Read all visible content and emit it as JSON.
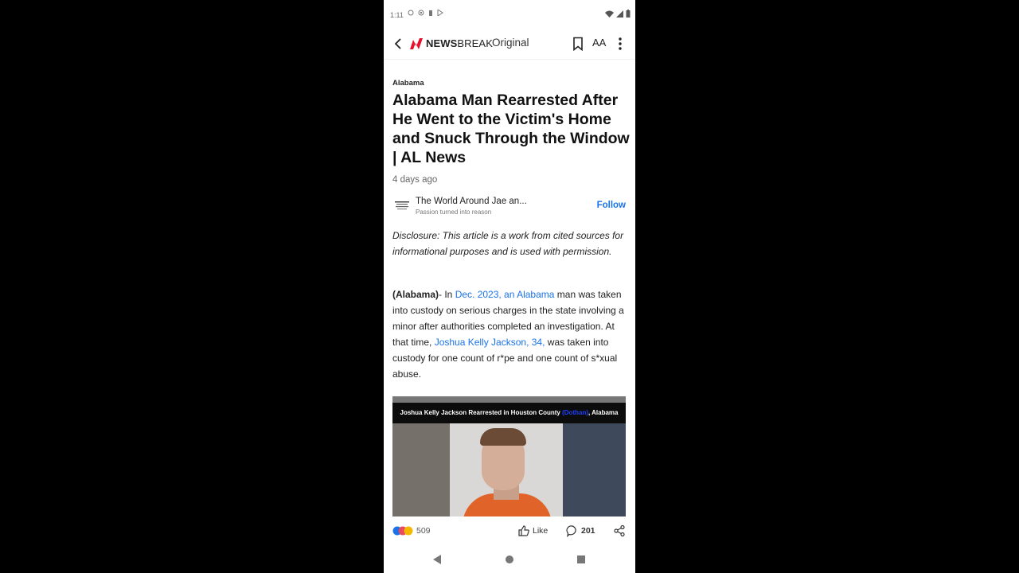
{
  "status_bar": {
    "time": "1:11"
  },
  "app_bar": {
    "brand_bold": "NEWS",
    "brand_light": "BREAK",
    "brand_suffix": "Original",
    "font_size_label": "AA"
  },
  "article": {
    "category": "Alabama",
    "headline": "Alabama Man Rearrested After He Went to the Victim's Home and Snuck Through the Window | AL News",
    "posted": "4 days ago",
    "source": {
      "name": "The World Around Jae an...",
      "tagline": "Passion turned into reason",
      "follow_label": "Follow"
    },
    "disclosure": "Disclosure: This article is a work from cited sources for informational purposes and is used with permission.",
    "paragraph": {
      "lead": "(Alabama)",
      "p1": "- In ",
      "link1": "Dec. 2023, an Alabama",
      "p2": " man was taken into custody on serious charges in the state involving a minor after authorities completed an investigation. At that time, ",
      "link2": "Joshua Kelly Jackson, 34,",
      "p3": " was taken into custody for one count of r*pe and one count of s*xual abuse."
    },
    "image_caption": {
      "before": "Joshua Kelly Jackson Rearrested in Houston County ",
      "highlight": "(Dothan)",
      "after": ", Alabama"
    }
  },
  "actions": {
    "reaction_count": "509",
    "like_label": "Like",
    "comment_count": "201"
  },
  "colors": {
    "accent": "#1a73e8",
    "brand_red": "#e8112d",
    "shirt": "#e0642a"
  }
}
